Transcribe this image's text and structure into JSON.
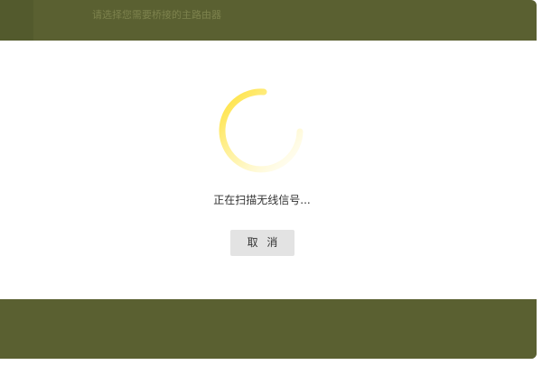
{
  "header": {
    "title": "请选择您需要桥接的主路由器"
  },
  "scan": {
    "status_text": "正在扫描无线信号...",
    "spinner_icon": "loading-spinner-icon",
    "spinner_color": "#ffe033"
  },
  "actions": {
    "cancel_label": "取 消"
  },
  "colors": {
    "overlay": "#5a6031",
    "panel": "#ffffff",
    "button": "#e3e3e3"
  }
}
